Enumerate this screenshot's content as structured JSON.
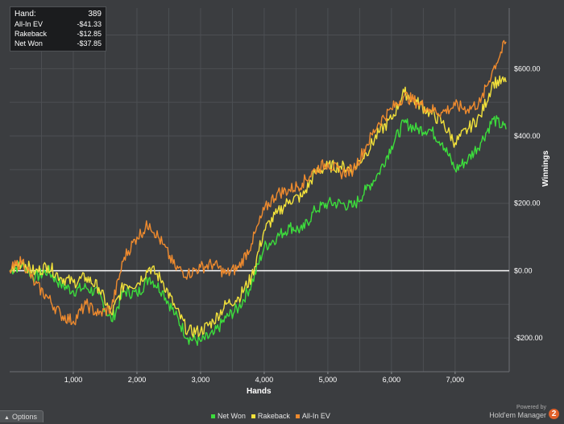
{
  "tooltip": {
    "rows": [
      {
        "label": "Hand:",
        "value": "389"
      },
      {
        "label": "All-In EV",
        "value": "-$41.33"
      },
      {
        "label": "Rakeback",
        "value": "-$12.85"
      },
      {
        "label": "Net Won",
        "value": "-$37.85"
      }
    ]
  },
  "options_label": "Options",
  "branding": {
    "powered": "Powered by",
    "name": "Hold'em Manager",
    "logo": "2"
  },
  "colors": {
    "background": "#3b3d40",
    "grid": "#4c4f53",
    "zero_line": "#ffffff",
    "net_won": "#3cdc3c",
    "rakeback": "#f2e13a",
    "all_in_ev": "#ee8a2e"
  },
  "chart_data": {
    "type": "line",
    "xlabel": "Hands",
    "ylabel": "Winnings",
    "xlim": [
      0,
      7850
    ],
    "ylim": [
      -300,
      780
    ],
    "x_ticks": [
      1000,
      2000,
      3000,
      4000,
      5000,
      6000,
      7000
    ],
    "x_tick_labels": [
      "1,000",
      "2,000",
      "3,000",
      "4,000",
      "5,000",
      "6,000",
      "7,000"
    ],
    "y_ticks": [
      -200,
      0,
      200,
      400,
      600
    ],
    "y_tick_labels": [
      "-$200.00",
      "$0.00",
      "$200.00",
      "$400.00",
      "$600.00"
    ],
    "legend_position": "bottom",
    "grid": true,
    "x": [
      0,
      200,
      400,
      600,
      800,
      1000,
      1200,
      1400,
      1600,
      1800,
      2000,
      2200,
      2400,
      2600,
      2800,
      3000,
      3200,
      3400,
      3600,
      3800,
      4000,
      4200,
      4400,
      4600,
      4800,
      5000,
      5200,
      5400,
      5600,
      5800,
      6000,
      6200,
      6400,
      6600,
      6800,
      7000,
      7200,
      7400,
      7600,
      7800
    ],
    "series": [
      {
        "name": "Net Won",
        "color": "#3cdc3c",
        "values": [
          0,
          20,
          -20,
          0,
          -40,
          -60,
          -50,
          -70,
          -150,
          -60,
          -70,
          -20,
          -60,
          -130,
          -200,
          -210,
          -190,
          -140,
          -110,
          -40,
          70,
          100,
          130,
          120,
          180,
          200,
          200,
          190,
          240,
          290,
          370,
          440,
          420,
          420,
          380,
          300,
          330,
          380,
          450,
          420
        ]
      },
      {
        "name": "Rakeback",
        "color": "#f2e13a",
        "values": [
          0,
          25,
          -5,
          15,
          -20,
          -35,
          -20,
          -50,
          -130,
          -40,
          -40,
          10,
          -30,
          -110,
          -180,
          -180,
          -150,
          -100,
          -80,
          -20,
          120,
          170,
          210,
          220,
          290,
          310,
          310,
          300,
          350,
          410,
          450,
          530,
          500,
          470,
          440,
          380,
          420,
          460,
          560,
          560
        ]
      },
      {
        "name": "All-In EV",
        "color": "#ee8a2e",
        "values": [
          0,
          30,
          -40,
          -80,
          -130,
          -150,
          -100,
          -130,
          -110,
          40,
          100,
          140,
          80,
          10,
          -10,
          10,
          20,
          -10,
          10,
          80,
          180,
          230,
          240,
          260,
          300,
          320,
          290,
          300,
          370,
          440,
          480,
          520,
          500,
          480,
          470,
          490,
          480,
          500,
          600,
          680
        ]
      }
    ]
  }
}
